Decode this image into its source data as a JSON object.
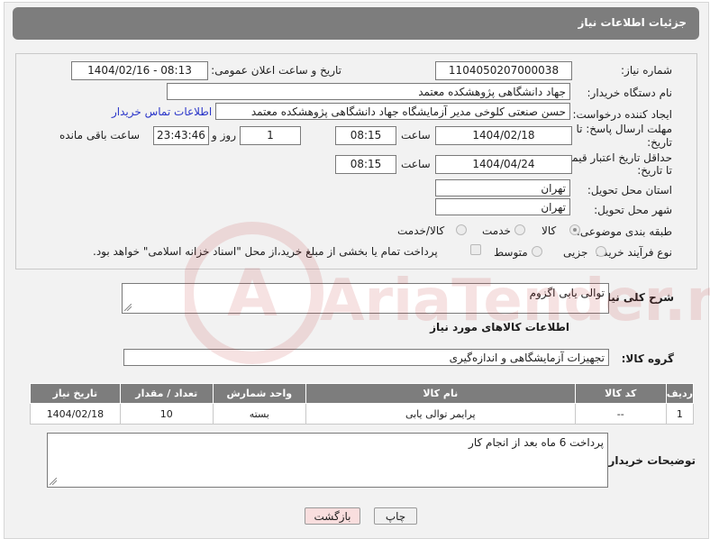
{
  "header": {
    "title": "جزئیات اطلاعات نیاز"
  },
  "form": {
    "need_number_label": "شماره نیاز:",
    "need_number": "1104050207000038",
    "announce_label": "تاریخ و ساعت اعلان عمومی:",
    "announce_value": "1404/02/16 - 08:13",
    "buyer_org_label": "نام دستگاه خریدار:",
    "buyer_org": "جهاد دانشگاهی پژوهشکده معتمد",
    "creator_label": "ایجاد کننده درخواست:",
    "creator": "حسن صنعتی کلوخی مدیر آزمایشگاه جهاد دانشگاهی پژوهشکده معتمد",
    "contact_link": "اطلاعات تماس خریدار",
    "deadline_label_1": "مهلت ارسال پاسخ: تا",
    "deadline_label_2": "تاریخ:",
    "deadline_date": "1404/02/18",
    "time_label": "ساعت",
    "deadline_time": "08:15",
    "days_value": "1",
    "days_label": "روز و",
    "remaining_value": "23:43:46",
    "remaining_label": "ساعت باقی مانده",
    "validity_label_1": "حداقل تاریخ اعتبار قیمت:",
    "validity_label_2": "تا تاریخ:",
    "validity_date": "1404/04/24",
    "validity_time": "08:15",
    "province_label": "استان محل تحویل:",
    "province": "تهران",
    "city_label": "شهر محل تحویل:",
    "city": "تهران",
    "category_label": "طبقه بندی موضوعی:",
    "category_options": [
      "کالا",
      "خدمت",
      "کالا/خدمت"
    ],
    "process_label": "نوع فرآیند خرید :",
    "process_options": [
      "جزیی",
      "متوسط"
    ],
    "payment_note": "پرداخت تمام یا بخشی از مبلغ خرید،از محل \"اسناد خزانه اسلامی\" خواهد بود."
  },
  "description": {
    "label": "شرح کلی نیاز:",
    "value": "توالی یابی اگزوم"
  },
  "goods": {
    "section_title": "اطلاعات کالاهای مورد نیاز",
    "group_label": "گروه کالا:",
    "group_value": "تجهیزات آزمایشگاهی و اندازه‌گیری",
    "columns": [
      "ردیف",
      "کد کالا",
      "نام کالا",
      "واحد شمارش",
      "تعداد / مقدار",
      "تاریخ نیاز"
    ],
    "rows": [
      [
        "1",
        "--",
        "پرایمر توالی یابی",
        "بسته",
        "10",
        "1404/02/18"
      ]
    ]
  },
  "buyer_notes": {
    "label": "توضیحات خریدار:",
    "value": "پرداخت 6 ماه بعد از انجام کار"
  },
  "buttons": {
    "print": "چاپ",
    "back": "بازگشت"
  },
  "watermark_text": "AriaTender.neT"
}
